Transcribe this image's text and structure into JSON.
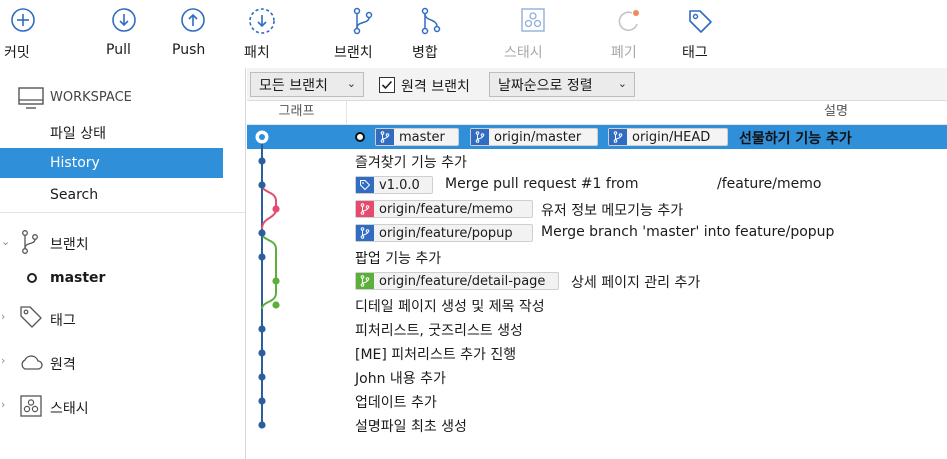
{
  "toolbar": {
    "commit": "커밋",
    "pull": "Pull",
    "push": "Push",
    "fetch": "패치",
    "branch": "브랜치",
    "merge": "병합",
    "stash": "스태시",
    "discard": "폐기",
    "tag": "태그"
  },
  "sidebar": {
    "workspace": "WORKSPACE",
    "file_status": "파일 상태",
    "history": "History",
    "search": "Search",
    "branches": "브랜치",
    "current_branch": "master",
    "tags": "태그",
    "remotes": "원격",
    "stashes": "스태시"
  },
  "filters": {
    "branch_filter": "모든 브랜치",
    "remote_branches": "원격 브랜치",
    "remote_checked": true,
    "sort": "날짜순으로 정렬"
  },
  "columns": {
    "graph": "그래프",
    "description": "설명"
  },
  "commits": [
    {
      "message": "선물하기 기능 추가",
      "labels": [
        "master",
        "origin/master",
        "origin/HEAD"
      ],
      "selected": true
    },
    {
      "message": "즐겨찾기 기능 추가",
      "labels": []
    },
    {
      "message": "Merge pull request #1 from",
      "message_tail": "/feature/memo",
      "tag": "v1.0.0"
    },
    {
      "message": "유저 정보 메모기능 추가",
      "labels": [
        "origin/feature/memo"
      ]
    },
    {
      "message": "Merge branch 'master' into feature/popup",
      "labels": [
        "origin/feature/popup"
      ]
    },
    {
      "message": "팝업 기능 추가",
      "labels": []
    },
    {
      "message": "상세 페이지 관리 추가",
      "labels": [
        "origin/feature/detail-page"
      ]
    },
    {
      "message": "디테일 페이지 생성 및 제목 작성",
      "labels": []
    },
    {
      "message": "피처리스트, 굿즈리스트 생성",
      "labels": []
    },
    {
      "message": "[ME] 피처리스트 추가 진행",
      "labels": []
    },
    {
      "message": "John 내용 추가",
      "labels": []
    },
    {
      "message": "업데이트 추가",
      "labels": []
    },
    {
      "message": "설명파일 최초 생성",
      "labels": []
    }
  ],
  "colors": {
    "accent": "#2f8fd8",
    "main_line": "#2c5f9e",
    "memo_line": "#e54b6e",
    "detail_line": "#5ab03b",
    "icon_blue": "#2f6cc2"
  },
  "icons": {
    "commit": "plus-circle-icon",
    "pull": "arrow-down-circle-icon",
    "push": "arrow-up-circle-icon",
    "fetch": "dashed-arrow-down-circle-icon",
    "branch": "branch-icon",
    "merge": "merge-icon",
    "stash": "stash-icon",
    "discard": "discard-icon",
    "tag": "tag-icon"
  }
}
